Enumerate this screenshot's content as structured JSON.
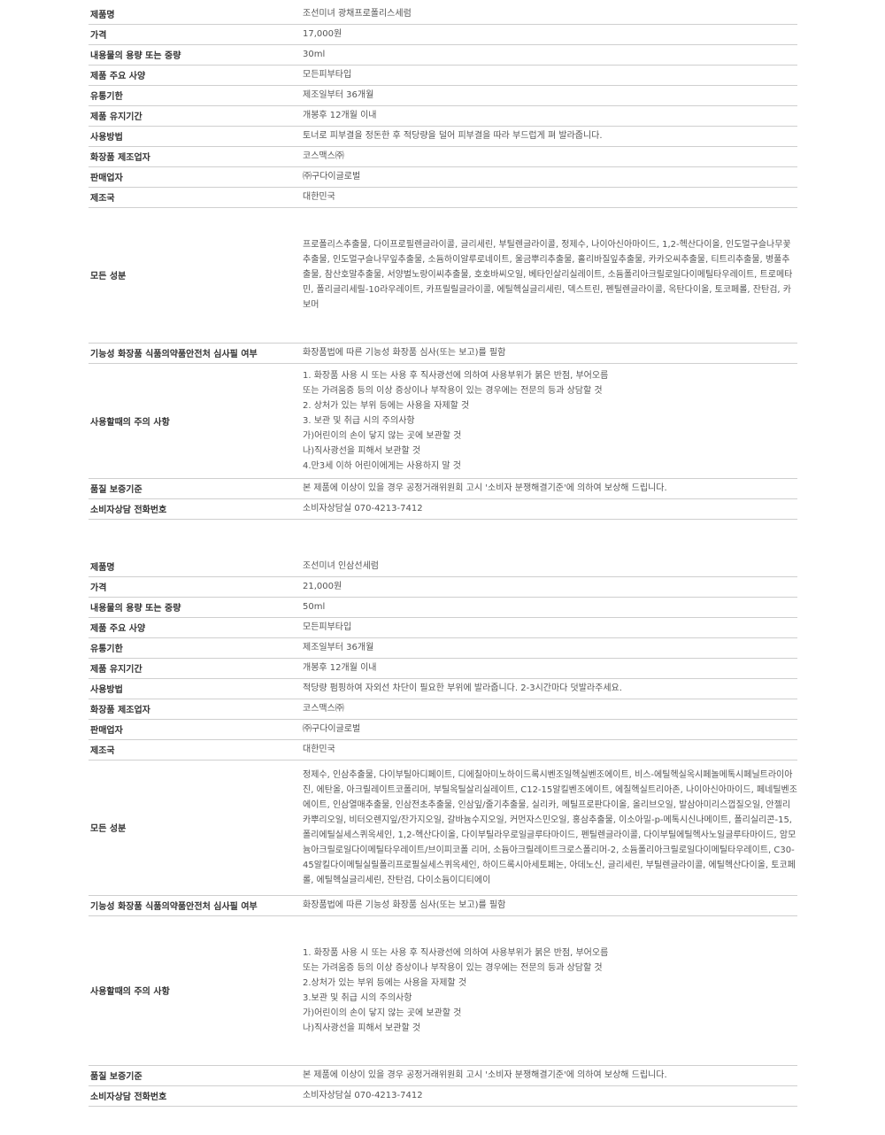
{
  "products": [
    {
      "rows": [
        {
          "label": "제품명",
          "value": "조선미녀 광채프로폴리스세럼"
        },
        {
          "label": "가격",
          "value": "17,000원"
        },
        {
          "label": "내용물의 용량 또는 중량",
          "value": "30ml"
        },
        {
          "label": "제품 주요 사양",
          "value": "모든피부타입"
        },
        {
          "label": "유통기한",
          "value": "제조일부터 36개월"
        },
        {
          "label": "제품 유지기간",
          "value": "개봉후 12개월 이내"
        },
        {
          "label": "사용방법",
          "value": "토너로 피부결을 정돈한 후 적당량을 덜어 피부결을 따라 부드럽게 펴 발라줍니다."
        },
        {
          "label": "화장품 제조업자",
          "value": "코스맥스㈜"
        },
        {
          "label": "판매업자",
          "value": "㈜구다이글로벌"
        },
        {
          "label": "제조국",
          "value": "대한민국"
        },
        {
          "label": "모든 성분",
          "value": "프로폴리스추출물, 다이프로필렌글라이콜, 글리세린, 부틸렌글라이콜, 정제수, 나이아신아마이드, 1,2-헥산다이올, 인도멀구슬나무꽃추출물, 인도멀구슬나무잎추출물, 소듐하이알루로네이트, 울금뿌리추출물, 홀리바질잎추출물, 카카오씨추출물, 티트리추출물, 병풀추출물, 참산호말추출물, 서양벌노랑이씨추출물, 호호바씨오일, 베타인살리실레이트, 소듐폴리아크릴로일다이메틸타우레이트, 트로메타민, 폴리글리세릴-10라우레이트, 카프릴릴글라이콜, 에틸헥실글리세린, 덱스트린, 펜틸렌글라이콜, 옥탄다이올, 토코페롤, 잔탄검, 카보머"
        },
        {
          "label": "기능성 화장품 식품의약품안전처 심사필 여부",
          "value": "화장품법에 따른 기능성 화장품 심사(또는 보고)를 필함"
        },
        {
          "label": "사용할때의 주의 사항",
          "value": "1. 화장품 사용 시 또는 사용 후 직사광선에 의하여 사용부위가 붉은 반점, 부어오름\n또는 가려움증 등의 이상 증상이나 부작용이 있는 경우에는 전문의 등과 상담할 것\n2. 상처가 있는 부위 등에는 사용을 자제할 것\n3. 보관 및 취급 시의 주의사항\n가)어린이의 손이 닿지 않는 곳에 보관할 것\n나)직사광선을 피해서 보관할 것\n4.만3세 이하 어린이에게는 사용하지 말 것"
        },
        {
          "label": "품질 보증기준",
          "value": "본 제품에 이상이 있을 경우 공정거래위원회 고시 '소비자 분쟁해결기준'에 의하여 보상해 드립니다."
        },
        {
          "label": "소비자상담 전화번호",
          "value": "소비자상담실 070-4213-7412"
        }
      ]
    },
    {
      "rows": [
        {
          "label": "제품명",
          "value": "조선미녀 인삼선세럼"
        },
        {
          "label": "가격",
          "value": "21,000원"
        },
        {
          "label": "내용물의 용량 또는 중량",
          "value": "50ml"
        },
        {
          "label": "제품 주요 사양",
          "value": "모든피부타입"
        },
        {
          "label": "유통기한",
          "value": "제조일부터 36개월"
        },
        {
          "label": "제품 유지기간",
          "value": "개봉후 12개월 이내"
        },
        {
          "label": "사용방법",
          "value": "적당량 펌핑하여 자외선 차단이 필요한 부위에 발라줍니다. 2-3시간마다 덧발라주세요."
        },
        {
          "label": "화장품 제조업자",
          "value": "코스맥스㈜"
        },
        {
          "label": "판매업자",
          "value": "㈜구다이글로벌"
        },
        {
          "label": "제조국",
          "value": "대한민국"
        },
        {
          "label": "모든 성분",
          "value": "정제수, 인삼추출물, 다이부틸아디페이트, 디에칠아미노하이드록시벤조일헥실벤조에이트, 비스-에틸헥실옥시페놀메톡시페닐트라이아진, 에탄올, 아크릴레이트코폴리머, 부틸옥틸살리실레이트, C12-15알킬벤조에이트, 에칠헥실트리아존, 나이아신아마이드, 페네틸벤조에이트, 인삼열매추출물, 인삼전초추출물, 인삼잎/줄기추출물, 실리카, 메틸프로판다이올, 올리브오일, 발삼아미리스껍질오일, 안젤리카뿌리오일, 비터오렌지잎/잔가지오일, 갈바늄수지오일, 커먼자스민오일, 홍삼추출물, 이소아밀-p-메톡시신나메이트, 폴리실리콘-15, 폴리에틸실세스퀴옥세인, 1,2-헥산다이올, 다이부틸라우로일글루타마이드, 펜틸렌글라이콜, 다이부틸에틸헥사노일글루타마이드, 암모늄아크릴로일다이메틸타우레이트/브이피코폴 리머, 소듐아크릴레이트크로스폴리머-2, 소듐폴리아크릴로일다이메틸타우레이트, C30-45알킬다이메틸실릴폴리프로필실세스퀴옥세인, 하이드록시아세토페논, 아데노신, 글리세린, 부틸렌글라이콜, 에틸헥산다이올, 토코페롤, 에틸헥실글리세린, 잔탄검, 다이소듐이디티에이"
        },
        {
          "label": "기능성 화장품 식품의약품안전처 심사필 여부",
          "value": "화장품법에 따른 기능성 화장품 심사(또는 보고)를 필함"
        },
        {
          "label": "사용할때의 주의 사항",
          "value": "1. 화장품 사용 시 또는 사용 후 직사광선에 의하여 사용부위가 붉은 반점, 부어오름\n또는 가려움증 등의 이상 증상이나 부작용이 있는 경우에는 전문의 등과 상담할 것\n2.상처가 있는 부위 등에는 사용을 자제할 것\n3.보관 및 취급 시의 주의사항\n가)어린이의 손이 닿지 않는 곳에 보관할 것\n나)직사광선을 피해서 보관할 것"
        },
        {
          "label": "품질 보증기준",
          "value": "본 제품에 이상이 있을 경우 공정거래위원회 고시 '소비자 분쟁해결기준'에 의하여 보상해 드립니다."
        },
        {
          "label": "소비자상담 전화번호",
          "value": "소비자상담실 070-4213-7412"
        }
      ]
    }
  ]
}
